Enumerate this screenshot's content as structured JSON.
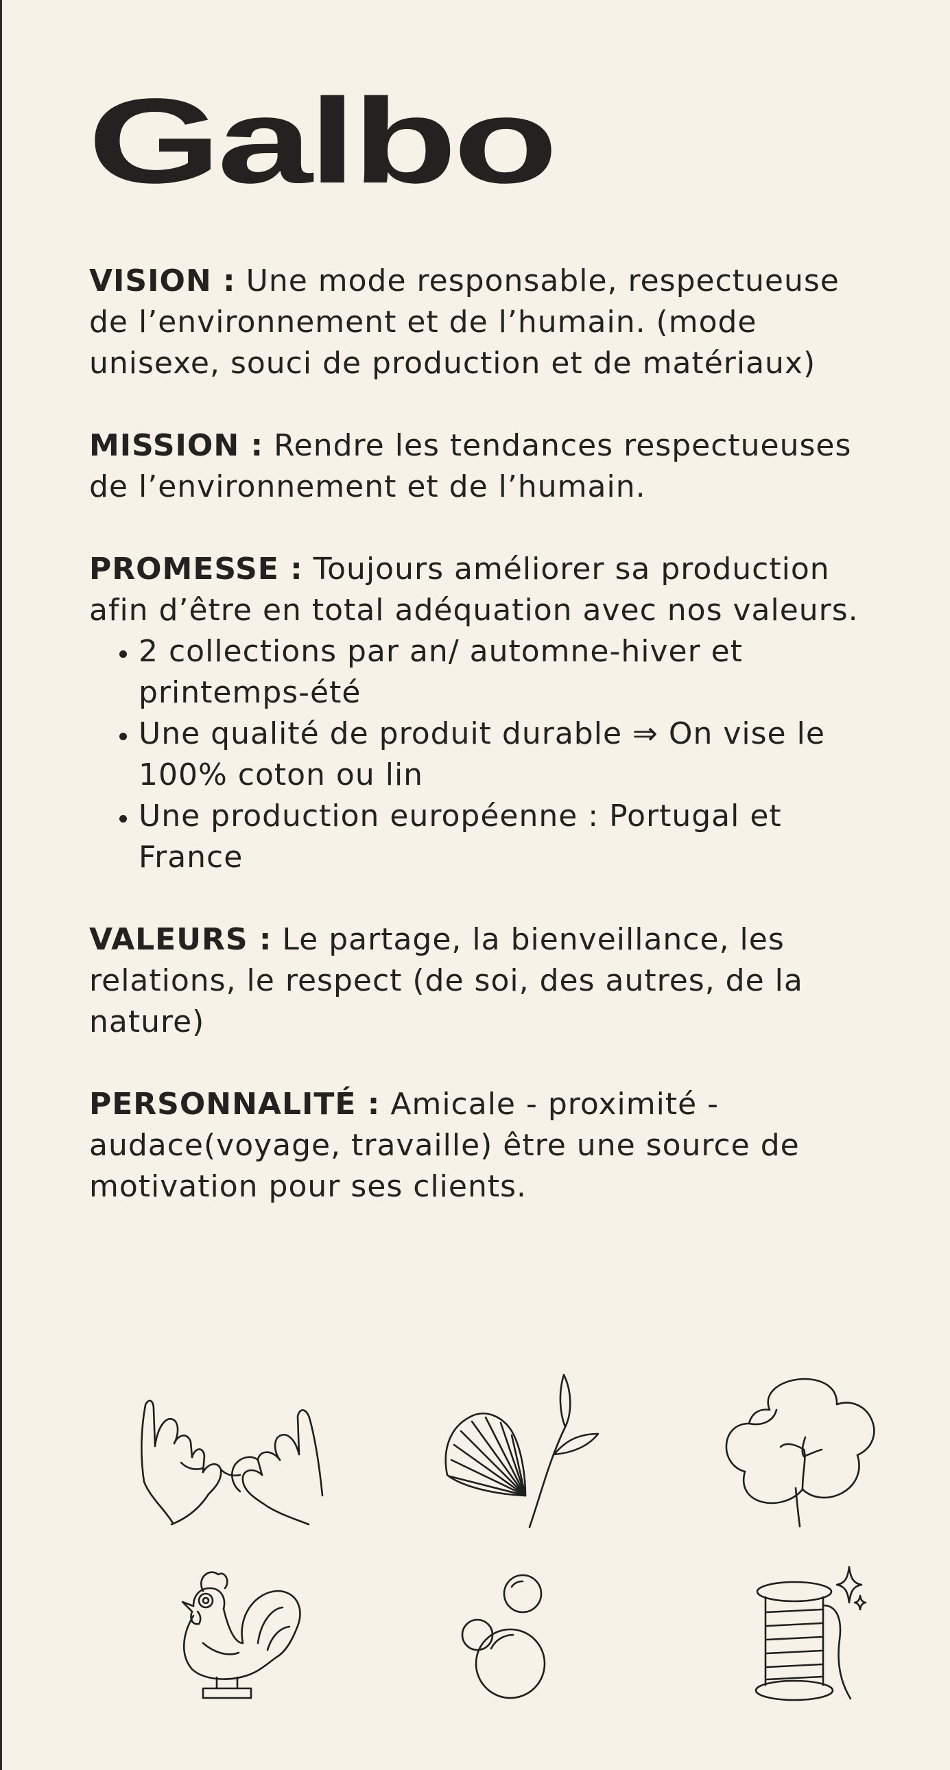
{
  "brand": {
    "name": "Galbo"
  },
  "sections": {
    "vision": {
      "label": "VISION :",
      "text": " Une mode responsable, respectueuse de l’environnement et de l’humain. (mode unisexe, souci de production et de matériaux)"
    },
    "mission": {
      "label": "MISSION :",
      "text": " Rendre les tendances respectueuses de l’environnement et de l’humain."
    },
    "promesse": {
      "label": "PROMESSE :",
      "text": " Toujours améliorer sa production afin d’être en total adéquation avec nos valeurs.",
      "bullets": [
        "2 collections par an/ automne-hiver et printemps-été",
        "Une qualité de produit durable ⇒ On vise le 100% coton ou lin",
        "Une production européenne : Portugal et France"
      ]
    },
    "valeurs": {
      "label": "VALEURS :",
      "text": " Le partage, la bienveillance, les relations, le respect (de soi, des autres, de la nature)"
    },
    "personnalite": {
      "label": "PERSONNALITÉ :",
      "text": " Amicale - proximité - audace(voyage, travaille) être une source de motivation pour ses clients."
    }
  },
  "icons": [
    "pinky-promise-hands-icon",
    "shell-and-plant-icon",
    "cotton-flower-icon",
    "rooster-icon",
    "bubbles-icon",
    "thread-spool-icon"
  ]
}
